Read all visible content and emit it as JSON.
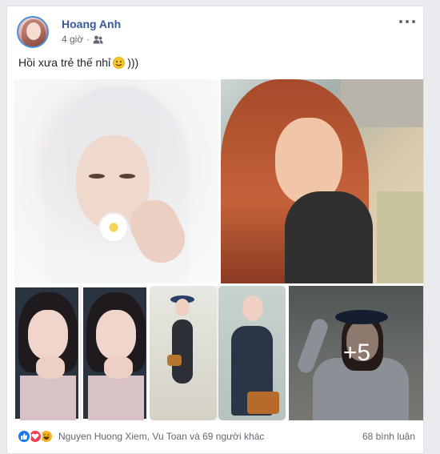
{
  "post": {
    "author": "Hoang Anh",
    "time": "4 giờ",
    "privacy_icon": "friends-icon",
    "text": "Hồi xưa trẻ thế nhỉ",
    "text_suffix": ")))",
    "emoji_icon": "smile-icon"
  },
  "photos": {
    "count": 7,
    "more_label": "+5"
  },
  "reactions": {
    "types": [
      "like-icon",
      "love-icon",
      "haha-icon"
    ],
    "names": "Nguyen Huong Xiem, Vu Toan và 69 người khác",
    "comments": "68 bình luận"
  },
  "colors": {
    "author": "#385898",
    "meta": "#606770",
    "like": "#1877f2",
    "love": "#f33e58",
    "haha": "#f7b125"
  }
}
